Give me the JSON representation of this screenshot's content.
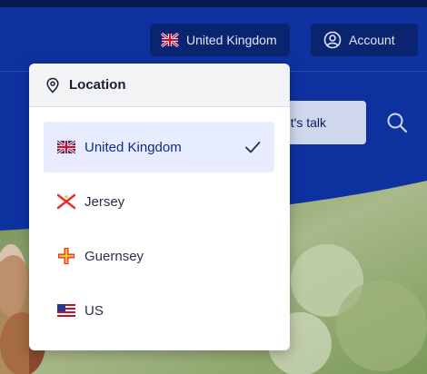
{
  "header": {
    "country_button_label": "United Kingdom",
    "account_button_label": "Account",
    "cta_label": "et's talk"
  },
  "dropdown": {
    "title": "Location",
    "options": [
      {
        "label": "United Kingdom",
        "flag": "uk-flag-icon",
        "selected": true
      },
      {
        "label": "Jersey",
        "flag": "jersey-flag-icon",
        "selected": false
      },
      {
        "label": "Guernsey",
        "flag": "guernsey-flag-icon",
        "selected": false
      },
      {
        "label": "US",
        "flag": "us-flag-icon",
        "selected": false
      }
    ]
  },
  "colors": {
    "header_bg": "#0e31a0",
    "selected_bg": "#e8ecff",
    "selected_text": "#0e2c88"
  }
}
